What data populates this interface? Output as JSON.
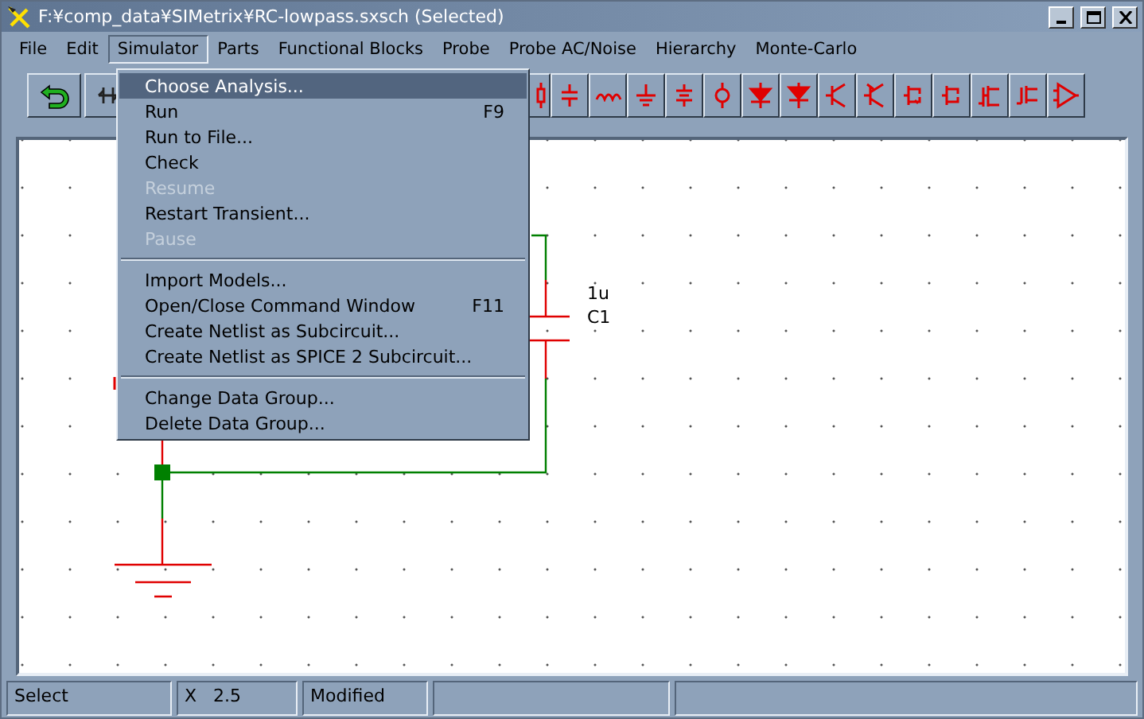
{
  "window": {
    "title": "F:¥comp_data¥SIMetrix¥RC-lowpass.sxsch (Selected)"
  },
  "menu_bar": [
    {
      "label": "File",
      "selected": false
    },
    {
      "label": "Edit",
      "selected": false
    },
    {
      "label": "Simulator",
      "selected": true
    },
    {
      "label": "Parts",
      "selected": false
    },
    {
      "label": "Functional Blocks",
      "selected": false
    },
    {
      "label": "Probe",
      "selected": false
    },
    {
      "label": "Probe AC/Noise",
      "selected": false
    },
    {
      "label": "Hierarchy",
      "selected": false
    },
    {
      "label": "Monte-Carlo",
      "selected": false
    }
  ],
  "open_menu": {
    "items": [
      {
        "kind": "item",
        "label": "Choose Analysis...",
        "selected": true,
        "disabled": false
      },
      {
        "kind": "item",
        "label": "Run",
        "shortcut": "F9",
        "selected": false,
        "disabled": false
      },
      {
        "kind": "item",
        "label": "Run to File...",
        "selected": false,
        "disabled": false
      },
      {
        "kind": "item",
        "label": "Check",
        "selected": false,
        "disabled": false
      },
      {
        "kind": "item",
        "label": "Resume",
        "selected": false,
        "disabled": true
      },
      {
        "kind": "item",
        "label": "Restart Transient...",
        "selected": false,
        "disabled": false
      },
      {
        "kind": "item",
        "label": "Pause",
        "selected": false,
        "disabled": true
      },
      {
        "kind": "separator"
      },
      {
        "kind": "item",
        "label": "Import Models...",
        "selected": false,
        "disabled": false
      },
      {
        "kind": "item",
        "label": "Open/Close Command Window",
        "shortcut": "F11",
        "selected": false,
        "disabled": false
      },
      {
        "kind": "item",
        "label": "Create Netlist as Subcircuit...",
        "selected": false,
        "disabled": false
      },
      {
        "kind": "item",
        "label": "Create Netlist as SPICE 2 Subcircuit...",
        "selected": false,
        "disabled": false
      },
      {
        "kind": "separator"
      },
      {
        "kind": "item",
        "label": "Change Data Group...",
        "selected": false,
        "disabled": false
      },
      {
        "kind": "item",
        "label": "Delete Data Group...",
        "selected": false,
        "disabled": false
      }
    ]
  },
  "schematic": {
    "component_labels": [
      "1u",
      "C1"
    ]
  },
  "status_bar": {
    "panes": [
      "Select",
      "X   2.5",
      "Modified"
    ]
  }
}
